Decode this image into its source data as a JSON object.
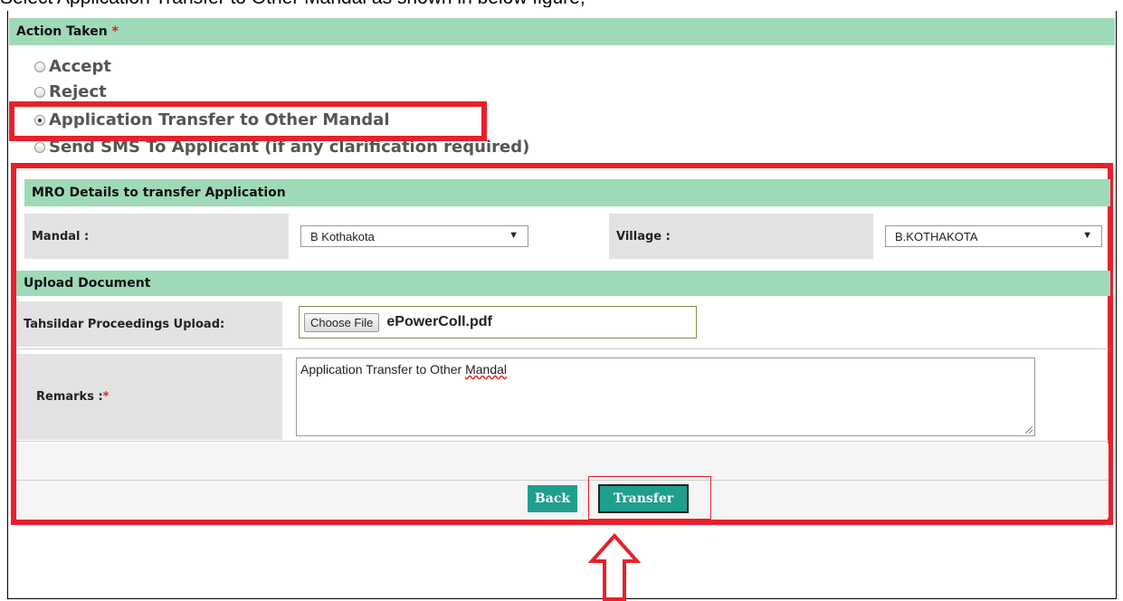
{
  "caption": "Select Application Transfer to Other Mandal as shown in below figure,",
  "action_taken": {
    "title": "Action Taken",
    "required_mark": "*",
    "options": [
      {
        "label": "Accept",
        "selected": false
      },
      {
        "label": "Reject",
        "selected": false
      },
      {
        "label": "Application Transfer to Other Mandal",
        "selected": true
      },
      {
        "label": "Send SMS To Applicant (if any clarification required)",
        "selected": false
      }
    ]
  },
  "mro": {
    "title": "MRO Details to transfer Application",
    "mandal_label": "Mandal :",
    "mandal_value": "B Kothakota",
    "village_label": "Village :",
    "village_value": "B.KOTHAKOTA"
  },
  "upload": {
    "title": "Upload Document",
    "proceedings_label": "Tahsildar Proceedings Upload:",
    "choose_file": "Choose File",
    "file_name": "ePowerColl.pdf",
    "remarks_label": "Remarks :",
    "remarks_required": "*",
    "remarks_text_1": "Application Transfer to Other ",
    "remarks_text_2": "Mandal"
  },
  "buttons": {
    "back": "Back",
    "transfer": "Transfer"
  },
  "colors": {
    "header_bg": "#9fdab8",
    "highlight": "#e8202c",
    "button": "#1f9e8e"
  }
}
